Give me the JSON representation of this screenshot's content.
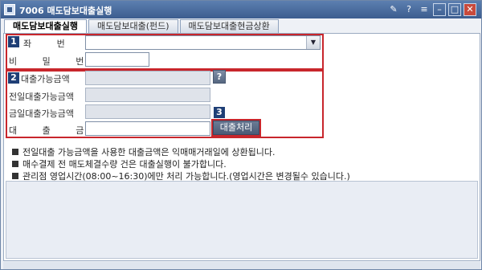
{
  "window": {
    "title": "7006 매도담보대출실행",
    "controls": [
      "pin-icon",
      "help-icon",
      "menu-icon",
      "minimize-icon",
      "maximize-icon",
      "close-icon"
    ]
  },
  "tabs": [
    {
      "label": "매도담보대출실행",
      "active": true
    },
    {
      "label": "매도담보대출(펀드)",
      "active": false
    },
    {
      "label": "매도담보대출현금상환",
      "active": false
    }
  ],
  "section1": {
    "badge": "1",
    "account_label": "좌 번 호",
    "account_value": "",
    "password_label": "비 밀 번 호",
    "password_value": ""
  },
  "section2": {
    "badge": "2",
    "available_label": "대출가능금액",
    "available_value": "",
    "help_label": "?",
    "prev_day_label": "전일대출가능금액",
    "prev_day_value": "",
    "today_label": "금일대출가능금액",
    "today_value": "",
    "amount_label": "대 출 금 액",
    "amount_value": ""
  },
  "section3": {
    "badge": "3",
    "process_button": "대출처리"
  },
  "notes": [
    "전일대출 가능금액을 사용한 대출금액은 익매매거래일에 상환됩니다.",
    "매수결제 전 매도체결수량 건은 대출실행이 불가합니다.",
    "관리점 영업시간(08:00~16:30)에만 처리 가능합니다.(영업시간은 변경될수 있습니다.)"
  ],
  "message_area": ""
}
